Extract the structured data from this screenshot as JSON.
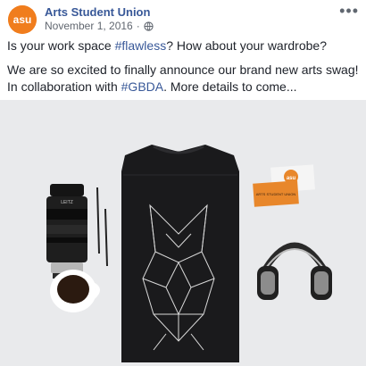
{
  "post": {
    "page_name": "Arts Student Union",
    "avatar_text": "asu",
    "date": "November 1, 2016",
    "date_separator": "·",
    "privacy_icon": "globe-icon",
    "more_icon": "more-options-icon",
    "line1_prefix": "Is your work space ",
    "line1_hashtag": "#flawless",
    "line1_suffix": "? How about your wardrobe?",
    "line2_prefix": "We are so excited to finally announce our brand new arts swag! In collaboration with ",
    "line2_hashtag": "#GBDA",
    "line2_suffix": ". More details to come..."
  },
  "image": {
    "lens_brand": "LEITZ",
    "card_logo": "asu",
    "card_label": "ARTS STUDENT UNION",
    "accent_color": "#e8872b",
    "background_color": "#e9eaec"
  },
  "colors": {
    "link": "#385898",
    "text": "#1d2129",
    "meta": "#616770",
    "avatar": "#f07d1d"
  }
}
